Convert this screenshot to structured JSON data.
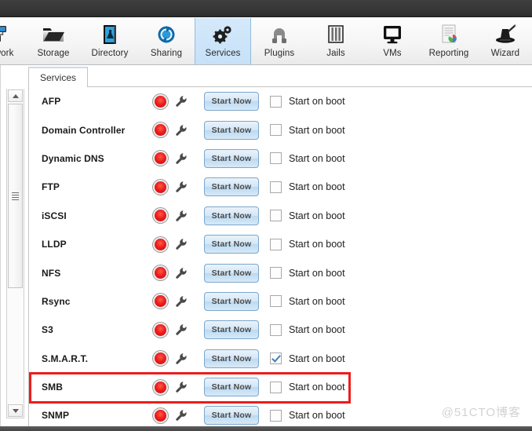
{
  "window": {
    "title": ""
  },
  "toolbar": {
    "items": [
      {
        "label": "Network",
        "icon": "network-icon",
        "selected": false
      },
      {
        "label": "Storage",
        "icon": "storage-icon",
        "selected": false
      },
      {
        "label": "Directory",
        "icon": "directory-icon",
        "selected": false
      },
      {
        "label": "Sharing",
        "icon": "sharing-icon",
        "selected": false
      },
      {
        "label": "Services",
        "icon": "gears-icon",
        "selected": true
      },
      {
        "label": "Plugins",
        "icon": "plugins-icon",
        "selected": false
      },
      {
        "label": "Jails",
        "icon": "jails-icon",
        "selected": false
      },
      {
        "label": "VMs",
        "icon": "monitor-icon",
        "selected": false
      },
      {
        "label": "Reporting",
        "icon": "reporting-icon",
        "selected": false
      },
      {
        "label": "Wizard",
        "icon": "wizard-icon",
        "selected": false
      }
    ],
    "selected_accent": "#c6e1f8"
  },
  "tabs": [
    {
      "label": "Services",
      "active": true
    }
  ],
  "table": {
    "toggle_label": "Start on boot",
    "action_label": "Start Now",
    "status_color": "#ed1c1c",
    "highlight_color": "#ee1c1c",
    "rows": [
      {
        "name": "AFP",
        "status": "stopped",
        "action": "Start Now",
        "start_on_boot": false,
        "highlighted": false
      },
      {
        "name": "Domain Controller",
        "status": "stopped",
        "action": "Start Now",
        "start_on_boot": false,
        "highlighted": false
      },
      {
        "name": "Dynamic DNS",
        "status": "stopped",
        "action": "Start Now",
        "start_on_boot": false,
        "highlighted": false
      },
      {
        "name": "FTP",
        "status": "stopped",
        "action": "Start Now",
        "start_on_boot": false,
        "highlighted": false
      },
      {
        "name": "iSCSI",
        "status": "stopped",
        "action": "Start Now",
        "start_on_boot": false,
        "highlighted": false
      },
      {
        "name": "LLDP",
        "status": "stopped",
        "action": "Start Now",
        "start_on_boot": false,
        "highlighted": false
      },
      {
        "name": "NFS",
        "status": "stopped",
        "action": "Start Now",
        "start_on_boot": false,
        "highlighted": false
      },
      {
        "name": "Rsync",
        "status": "stopped",
        "action": "Start Now",
        "start_on_boot": false,
        "highlighted": false
      },
      {
        "name": "S3",
        "status": "stopped",
        "action": "Start Now",
        "start_on_boot": false,
        "highlighted": false
      },
      {
        "name": "S.M.A.R.T.",
        "status": "stopped",
        "action": "Start Now",
        "start_on_boot": true,
        "highlighted": false
      },
      {
        "name": "SMB",
        "status": "stopped",
        "action": "Start Now",
        "start_on_boot": false,
        "highlighted": true
      },
      {
        "name": "SNMP",
        "status": "stopped",
        "action": "Start Now",
        "start_on_boot": false,
        "highlighted": false
      }
    ]
  },
  "scrollbar": {
    "up_icon": "triangle-up-icon",
    "down_icon": "triangle-down-icon",
    "grip_icon": "grip-icon"
  },
  "watermark": "@51CTO博客"
}
